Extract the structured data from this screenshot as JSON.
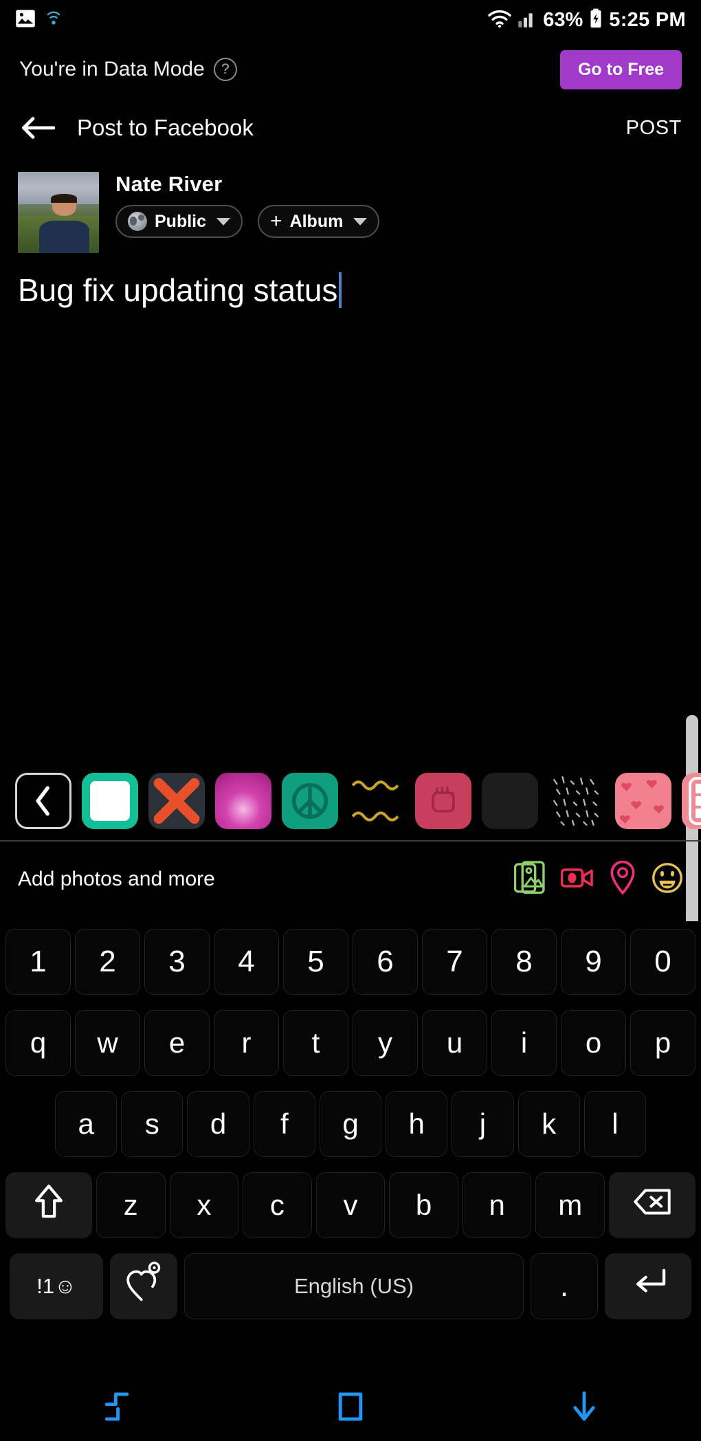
{
  "status_bar": {
    "left_icons": [
      "image-icon",
      "wifi-hotspot-icon"
    ],
    "right_icons": [
      "wifi-icon",
      "signal-icon",
      "battery-charging-icon"
    ],
    "battery_percent": "63%",
    "time": "5:25 PM"
  },
  "data_banner": {
    "message": "You're in Data Mode",
    "help_icon": "?",
    "cta_label": "Go to Free",
    "cta_color": "#A23AC9"
  },
  "app_bar": {
    "back_icon": "back-arrow-icon",
    "title": "Post to Facebook",
    "post_label": "POST"
  },
  "composer": {
    "user_name": "Nate River",
    "privacy_chip": {
      "label": "Public",
      "icon": "globe-icon"
    },
    "album_chip": {
      "label": "Album",
      "icon": "plus-icon"
    },
    "status_text": "Bug fix updating status"
  },
  "sticker_bar": {
    "back_icon": "chevron-left-icon",
    "items": [
      {
        "name": "blank-white-sticker",
        "color": "#12bf96"
      },
      {
        "name": "x-mark-sticker",
        "color": "#e8502a"
      },
      {
        "name": "pink-heart-sticker",
        "color": "#d243ad"
      },
      {
        "name": "peace-sign-sticker",
        "color": "#0f9e7e"
      },
      {
        "name": "gold-squiggle-sticker",
        "color": "#c9a227"
      },
      {
        "name": "raised-fist-sticker",
        "color": "#c73f5d"
      },
      {
        "name": "plain-dark-sticker",
        "color": "#1d1d1d"
      },
      {
        "name": "noise-texture-sticker",
        "color": "#9a9a9a"
      },
      {
        "name": "hearts-pattern-sticker",
        "color": "#f2808f"
      },
      {
        "name": "all-stickers-grid-sticker",
        "color": "#ef8b97"
      }
    ]
  },
  "add_bar": {
    "label": "Add photos and more",
    "icons": [
      {
        "name": "photo-gallery-icon",
        "color": "#8ed06b"
      },
      {
        "name": "video-camera-icon",
        "color": "#ef2d56"
      },
      {
        "name": "location-pin-icon",
        "color": "#ef2d78"
      },
      {
        "name": "emoji-smiley-icon",
        "color": "#e8c252"
      }
    ]
  },
  "keyboard": {
    "row_numbers": [
      "1",
      "2",
      "3",
      "4",
      "5",
      "6",
      "7",
      "8",
      "9",
      "0"
    ],
    "row_top": [
      "q",
      "w",
      "e",
      "r",
      "t",
      "y",
      "u",
      "i",
      "o",
      "p"
    ],
    "row_home": [
      "a",
      "s",
      "d",
      "f",
      "g",
      "h",
      "j",
      "k",
      "l"
    ],
    "row_bottom": [
      "z",
      "x",
      "c",
      "v",
      "b",
      "n",
      "m"
    ],
    "shift_icon": "shift-up-arrow-icon",
    "backspace_icon": "backspace-icon",
    "symbols_label": "!1☺",
    "sticker_key_icon": "heart-sticker-settings-icon",
    "space_label": "English (US)",
    "period_label": ".",
    "enter_icon": "enter-return-icon"
  },
  "nav_bar": {
    "items": [
      {
        "name": "recents-nav-button",
        "icon": "recents-icon"
      },
      {
        "name": "home-nav-button",
        "icon": "home-icon"
      },
      {
        "name": "hide-keyboard-nav-button",
        "icon": "down-arrow-icon"
      }
    ],
    "color": "#2196f3"
  }
}
